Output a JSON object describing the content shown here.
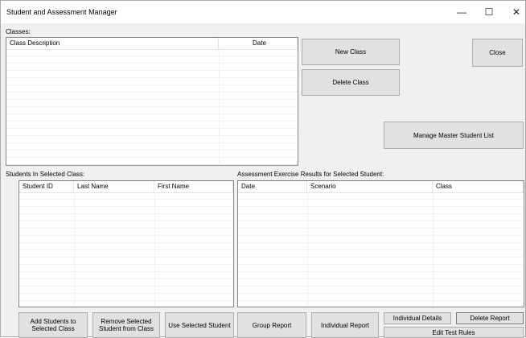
{
  "window": {
    "title": "Student and Assessment Manager",
    "controls": {
      "minimize": "—",
      "maximize": "☐",
      "close": "✕"
    }
  },
  "classes": {
    "label": "Classes:",
    "columns": [
      "Class Description",
      "Date"
    ],
    "rows": []
  },
  "students": {
    "label": "Students In Selected Class:",
    "columns": [
      "Student ID",
      "Last Name",
      "First Name"
    ],
    "rows": []
  },
  "results": {
    "label": "Assessment Exercise Results for Selected Student:",
    "columns": [
      "Date",
      "Scenario",
      "Class"
    ],
    "rows": []
  },
  "buttons": {
    "new_class": "New Class",
    "delete_class": "Delete Class",
    "close": "Close",
    "manage_master": "Manage Master Student List",
    "add_students": "Add Students to Selected Class",
    "remove_selected": "Remove Selected Student from Class",
    "use_selected": "Use Selected Student",
    "group_report": "Group Report",
    "individual_report": "Individual Report",
    "individual_details": "Individual Details",
    "delete_report": "Delete Report",
    "edit_test_rules": "Edit Test Rules"
  }
}
